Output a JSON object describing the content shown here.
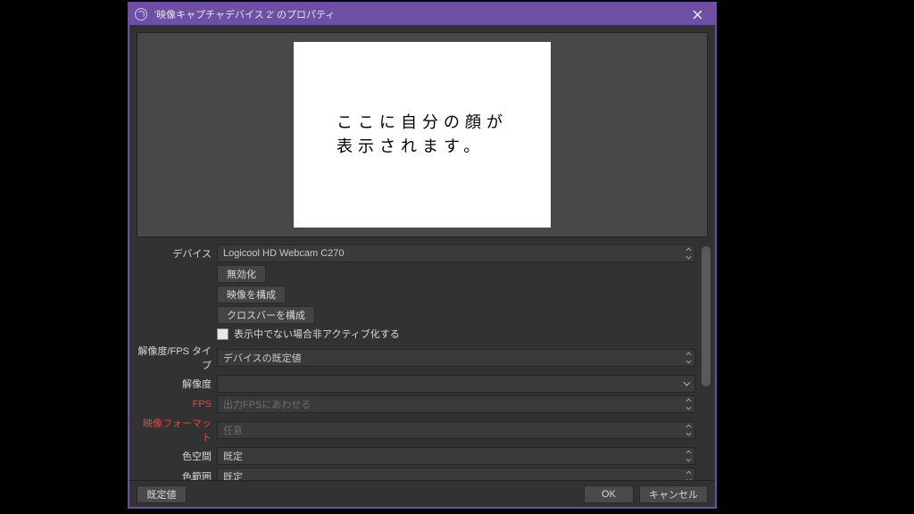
{
  "window": {
    "title": "'映像キャプチャデバイス 2' のプロパティ"
  },
  "preview": {
    "placeholder_text": "ここに自分の顔が\n表示されます。"
  },
  "form": {
    "device": {
      "label": "デバイス",
      "value": "Logicool HD Webcam C270"
    },
    "disable_btn": "無効化",
    "configure_video_btn": "映像を構成",
    "configure_crossbar_btn": "クロスバーを構成",
    "deactivate_when_hidden": {
      "label": "表示中でない場合非アクティブ化する",
      "checked": false
    },
    "res_fps_type": {
      "label": "解像度/FPS タイプ",
      "value": "デバイスの既定値"
    },
    "resolution": {
      "label": "解像度",
      "value": ""
    },
    "fps": {
      "label": "FPS",
      "value": "出力FPSにあわせる"
    },
    "video_format": {
      "label": "映像フォーマット",
      "value": "任意"
    },
    "color_space": {
      "label": "色空間",
      "value": "既定"
    },
    "color_range": {
      "label": "色範囲",
      "value": "既定"
    }
  },
  "buttons": {
    "defaults": "既定値",
    "ok": "OK",
    "cancel": "キャンセル"
  }
}
